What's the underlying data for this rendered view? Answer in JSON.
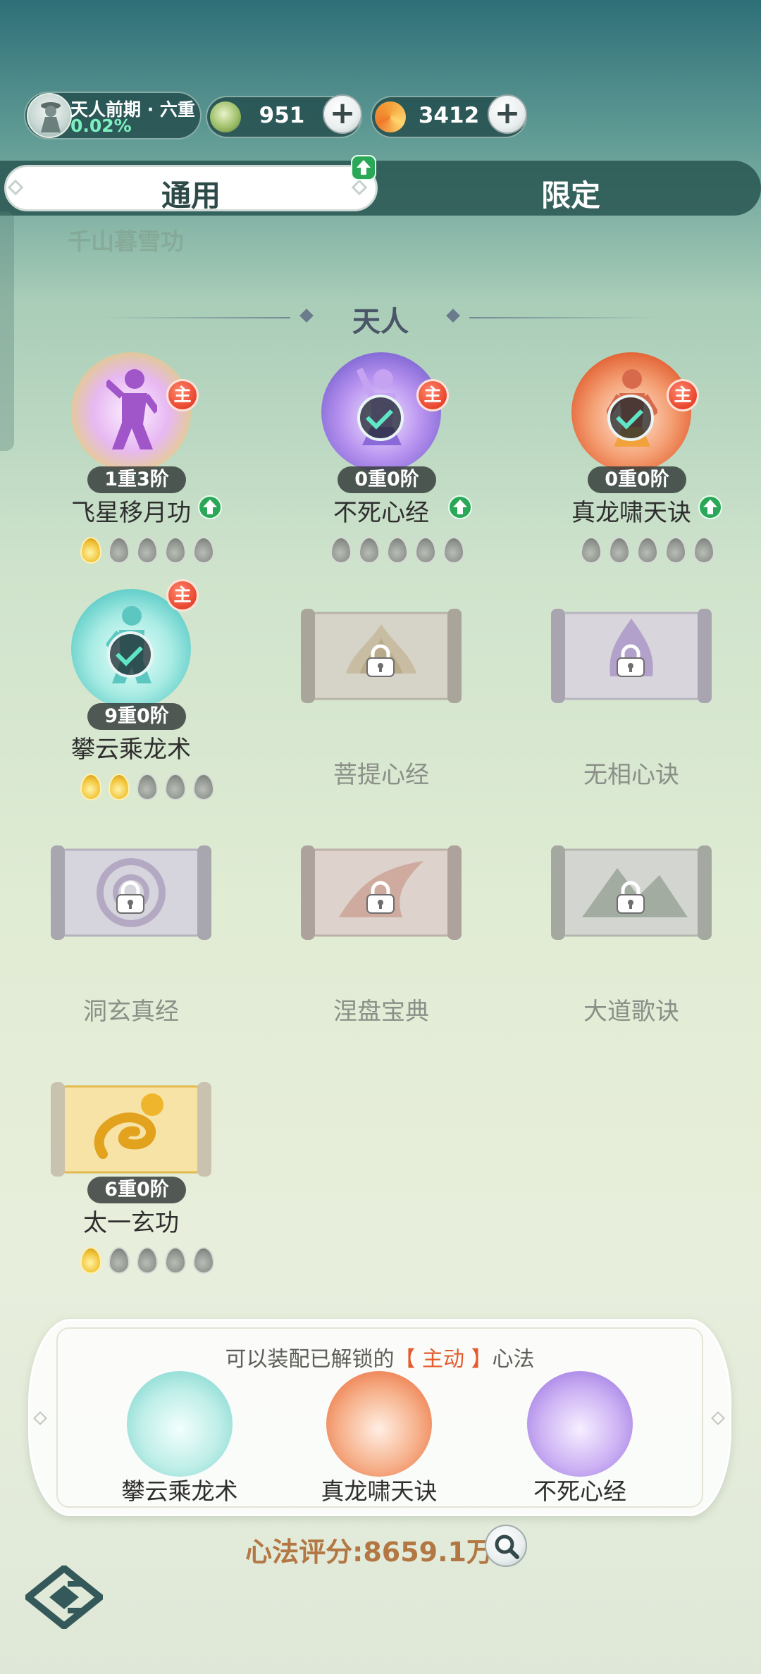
{
  "top_bar": {
    "realm_name": "天人前期 · 六重",
    "realm_progress": "0.02%",
    "resource_1_value": "951",
    "resource_2_value": "3412",
    "resource_1_icon": "jade-gourd-icon",
    "resource_2_icon": "spirit-swirl-icon"
  },
  "tabs": [
    {
      "label": "通用",
      "active": true
    },
    {
      "label": "限定",
      "active": false
    }
  ],
  "previous_section_label": "千山暮雪功",
  "section_title": "天人",
  "skills": [
    {
      "name": "飞星移月功",
      "rank": "1重3阶",
      "main": "主",
      "equipped": false,
      "upgrade": true,
      "stars": 1,
      "theme": "#c58be0"
    },
    {
      "name": "不死心经",
      "rank": "0重0阶",
      "main": "主",
      "equipped": true,
      "upgrade": true,
      "stars": 0,
      "theme": "#9b74e0"
    },
    {
      "name": "真龙啸天诀",
      "rank": "0重0阶",
      "main": "主",
      "equipped": true,
      "upgrade": true,
      "stars": 0,
      "theme": "#f07a45"
    },
    {
      "name": "攀云乘龙术",
      "rank": "9重0阶",
      "main": "主",
      "equipped": true,
      "upgrade": false,
      "stars": 2,
      "theme": "#6fd8d0"
    },
    {
      "name": "菩提心经",
      "locked": true
    },
    {
      "name": "无相心诀",
      "locked": true
    },
    {
      "name": "洞玄真经",
      "locked": true
    },
    {
      "name": "涅盘宝典",
      "locked": true
    },
    {
      "name": "大道歌诀",
      "locked": true
    },
    {
      "name": "太一玄功",
      "rank": "6重0阶",
      "stars": 1,
      "scroll": true
    }
  ],
  "loadout": {
    "tip_prefix": "可以装配已解锁的",
    "tip_highlight": "【 主动 】",
    "tip_suffix": "心法",
    "slots": [
      {
        "name": "攀云乘龙术",
        "theme": "#6fd8d0"
      },
      {
        "name": "真龙啸天诀",
        "theme": "#f07a45"
      },
      {
        "name": "不死心经",
        "theme": "#9b74e0"
      }
    ]
  },
  "score_text": "心法评分:8659.1万",
  "colors": {
    "accent_red": "#e8442c",
    "accent_green": "#2aa858",
    "score_brown": "#b27742"
  }
}
